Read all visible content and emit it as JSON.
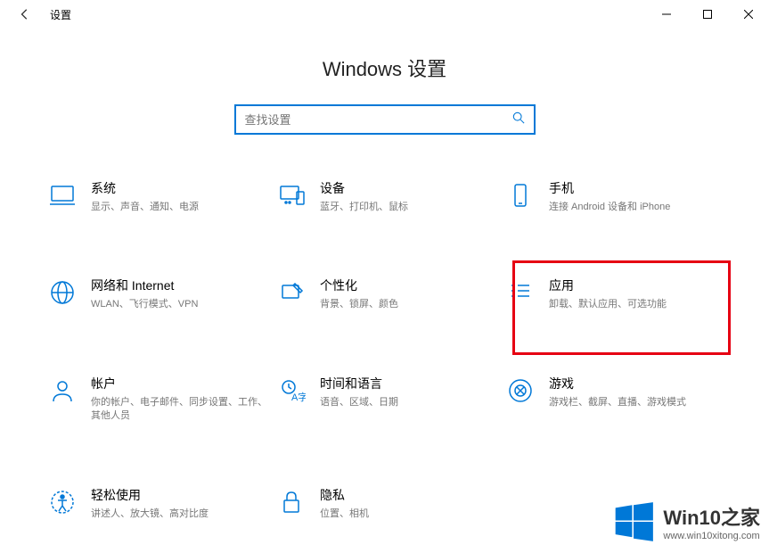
{
  "window": {
    "title": "设置"
  },
  "header": {
    "page_title": "Windows 设置"
  },
  "search": {
    "placeholder": "查找设置"
  },
  "tiles": {
    "system": {
      "title": "系统",
      "desc": "显示、声音、通知、电源"
    },
    "devices": {
      "title": "设备",
      "desc": "蓝牙、打印机、鼠标"
    },
    "phone": {
      "title": "手机",
      "desc": "连接 Android 设备和 iPhone"
    },
    "network": {
      "title": "网络和 Internet",
      "desc": "WLAN、飞行模式、VPN"
    },
    "personalization": {
      "title": "个性化",
      "desc": "背景、锁屏、颜色"
    },
    "apps": {
      "title": "应用",
      "desc": "卸载、默认应用、可选功能"
    },
    "accounts": {
      "title": "帐户",
      "desc": "你的帐户、电子邮件、同步设置、工作、其他人员"
    },
    "time": {
      "title": "时间和语言",
      "desc": "语音、区域、日期"
    },
    "gaming": {
      "title": "游戏",
      "desc": "游戏栏、截屏、直播、游戏模式"
    },
    "ease": {
      "title": "轻松使用",
      "desc": "讲述人、放大镜、高对比度"
    },
    "privacy": {
      "title": "隐私",
      "desc": "位置、相机"
    }
  },
  "watermark": {
    "main": "Win10之家",
    "sub": "www.win10xitong.com"
  }
}
